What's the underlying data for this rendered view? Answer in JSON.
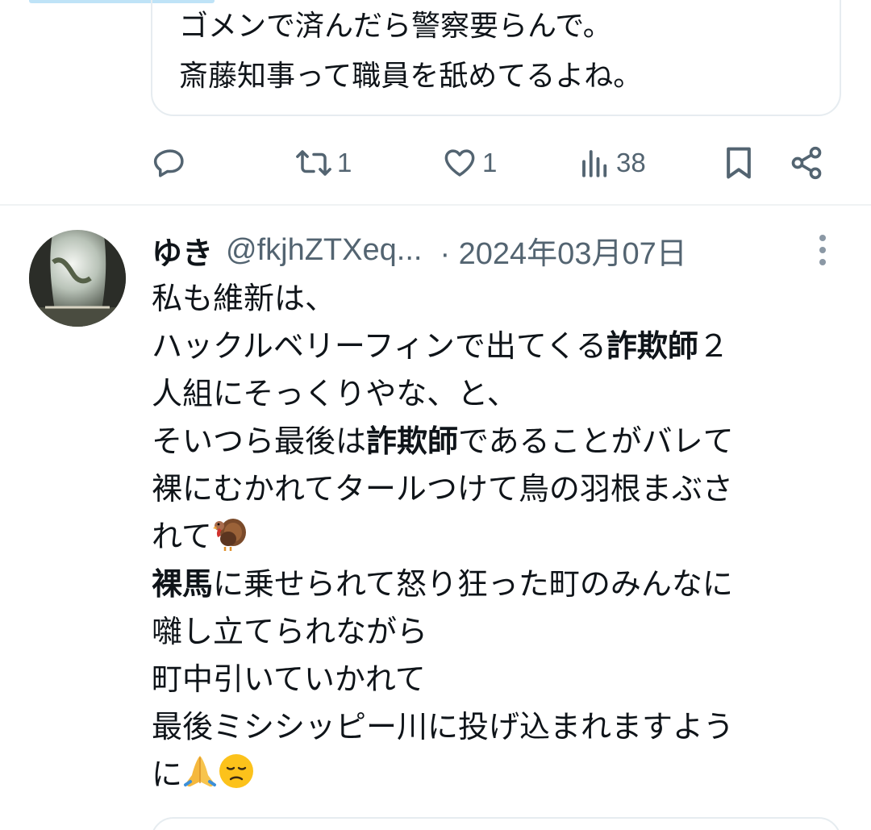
{
  "quoted_tweet": {
    "lines": [
      "ゴメンで済んだら警察要らんで。",
      "斎藤知事って職員を舐めてるよね。"
    ]
  },
  "actions": {
    "reply_count": "",
    "retweet_count": "1",
    "like_count": "1",
    "view_count": "38"
  },
  "reply_tweet": {
    "display_name": "ゆき",
    "handle": "@fkjhZTXeq...",
    "date": "· 2024年03月07日",
    "body_lines": [
      [
        {
          "t": "私も維新は、"
        }
      ],
      [
        {
          "t": "ハックルベリーフィンで出てくる"
        },
        {
          "t": "詐欺師",
          "b": true
        },
        {
          "t": "２"
        }
      ],
      [
        {
          "t": "人組にそっくりやな、と、"
        }
      ],
      [
        {
          "t": "そいつら最後は"
        },
        {
          "t": "詐欺師",
          "b": true
        },
        {
          "t": "であることがバレて"
        }
      ],
      [
        {
          "t": "裸にむかれてタールつけて鳥の羽根まぶさ"
        }
      ],
      [
        {
          "t": "れて"
        },
        {
          "emoji": "turkey"
        }
      ],
      [
        {
          "t": "裸馬",
          "b": true
        },
        {
          "t": "に乗せられて怒り狂った町のみんなに"
        }
      ],
      [
        {
          "t": "囃し立てられながら"
        }
      ],
      [
        {
          "t": "町中引いていかれて"
        }
      ],
      [
        {
          "t": "最後ミシシッピー川に投げ込まれますよう"
        }
      ],
      [
        {
          "t": "に"
        },
        {
          "emoji": "folded-hands"
        },
        {
          "emoji": "disappointed-face"
        }
      ]
    ]
  },
  "colors": {
    "text": "#0f1419",
    "muted": "#536471",
    "border": "#e6ecf0"
  }
}
